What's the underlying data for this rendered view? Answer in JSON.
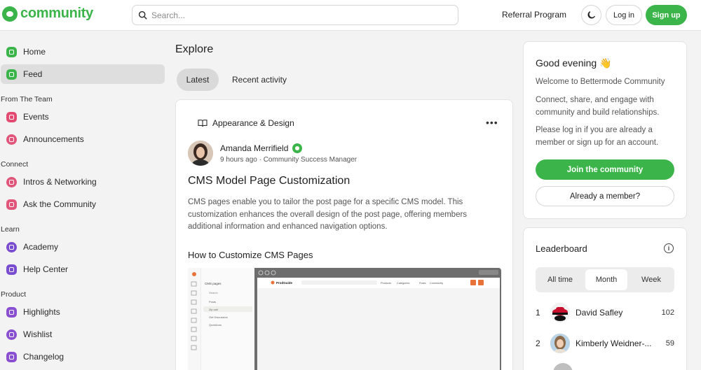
{
  "header": {
    "logo_text": "community",
    "search_placeholder": "Search...",
    "referral_label": "Referral Program",
    "login_label": "Log in",
    "signup_label": "Sign up"
  },
  "sidebar": {
    "home": "Home",
    "feed": "Feed",
    "sections": [
      {
        "title": "From The Team",
        "items": [
          "Events",
          "Announcements"
        ]
      },
      {
        "title": "Connect",
        "items": [
          "Intros & Networking",
          "Ask the Community"
        ]
      },
      {
        "title": "Learn",
        "items": [
          "Academy",
          "Help Center"
        ]
      },
      {
        "title": "Product",
        "items": [
          "Highlights",
          "Wishlist",
          "Changelog"
        ]
      }
    ]
  },
  "main": {
    "title": "Explore",
    "tabs": [
      "Latest",
      "Recent activity"
    ],
    "post": {
      "category": "Appearance & Design",
      "author": "Amanda Merrifield",
      "meta": "9 hours ago · Community Success Manager",
      "title": "CMS Model Page Customization",
      "body": "CMS pages enable you to tailor the post page for a specific CMS model. This customization enhances the overall design of the post page, offering members additional information and enhanced navigation options.",
      "subheading": "How to Customize CMS Pages",
      "screenshot": {
        "sidebar_title": "CMS pages",
        "sidebar_items": [
          "Posts",
          "Zip call",
          "Get Discussion",
          "Questions"
        ],
        "search_label": "Search",
        "topbar_brand": "ProdGuide",
        "topbar_links": [
          "Products",
          "Categories",
          "Posts",
          "Community"
        ]
      }
    }
  },
  "right": {
    "greeting": "Good evening 👋",
    "welcome": "Welcome to Bettermode Community",
    "blurb1": "Connect, share, and engage with community and build relationships.",
    "blurb2": "Please log in if you are already a member or sign up for an account.",
    "join_label": "Join the community",
    "member_label": "Already a member?"
  },
  "leaderboard": {
    "title": "Leaderboard",
    "tabs": [
      "All time",
      "Month",
      "Week"
    ],
    "active_tab": "Month",
    "rows": [
      {
        "rank": "1",
        "name": "David Safley",
        "score": "102"
      },
      {
        "rank": "2",
        "name": "Kimberly Weidner-...",
        "score": "59"
      }
    ]
  },
  "colors": {
    "brand": "#3bb54a",
    "icon_home": "#3bb54a",
    "icon_events": "#e24a72",
    "icon_announcements": "#e2557a",
    "icon_connect": "#e2557a",
    "icon_learn": "#7a4ccf",
    "icon_product": "#8a4fd1"
  }
}
